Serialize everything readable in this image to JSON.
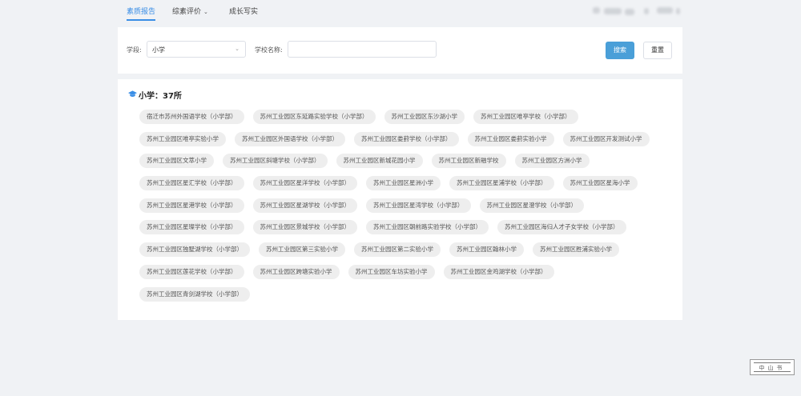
{
  "nav": {
    "tabs": [
      {
        "label": "素质报告",
        "active": true
      },
      {
        "label": "综素评价",
        "dropdown": true
      },
      {
        "label": "成长写实"
      }
    ]
  },
  "filters": {
    "stage_label": "学段:",
    "stage_value": "小学",
    "school_label": "学校名称:",
    "school_value": "",
    "school_placeholder": "",
    "search_button": "搜索",
    "reset_button": "重置"
  },
  "results": {
    "title": "小学：37所",
    "schools": [
      "宿迁市苏州外国语学校（小学部）",
      "苏州工业园区东延路实验学校（小学部）",
      "苏州工业园区东沙湖小学",
      "苏州工业园区唯亭学校（小学部）",
      "苏州工业园区唯亭实验小学",
      "苏州工业园区外国语学校（小学部）",
      "苏州工业园区娄葑学校（小学部）",
      "苏州工业园区娄葑实验小学",
      "苏州工业园区开发测试小学",
      "苏州工业园区文萃小学",
      "苏州工业园区斜塘学校（小学部）",
      "苏州工业园区新城花园小学",
      "苏州工业园区新融学校",
      "苏州工业园区方洲小学",
      "苏州工业园区星汇学校（小学部）",
      "苏州工业园区星洋学校（小学部）",
      "苏州工业园区星洲小学",
      "苏州工业园区星浦学校（小学部）",
      "苏州工业园区星海小学",
      "苏州工业园区星港学校（小学部）",
      "苏州工业园区星湖学校（小学部）",
      "苏州工业园区星湾学校（小学部）",
      "苏州工业园区星澄学校（小学部）",
      "苏州工业园区星璨学校（小学部）",
      "苏州工业园区景城学校（小学部）",
      "苏州工业园区朝前路实验学校（小学部）",
      "苏州工业园区海归人才子女学校（小学部）",
      "苏州工业园区独墅湖学校（小学部）",
      "苏州工业园区第三实验小学",
      "苏州工业园区第二实验小学",
      "苏州工业园区翰林小学",
      "苏州工业园区胜浦实验小学",
      "苏州工业园区莲花学校（小学部）",
      "苏州工业园区跨塘实验小学",
      "苏州工业园区车坊实验小学",
      "苏州工业园区金鸡湖学校（小学部）",
      "苏州工业园区青剑湖学校（小学部）"
    ]
  },
  "watermark": {
    "text": "中山书"
  },
  "colors": {
    "accent": "#3a8ee6",
    "search_button": "#4a9fd8",
    "page_bg": "#f0f2f5",
    "chip_bg": "#eeeeee"
  }
}
